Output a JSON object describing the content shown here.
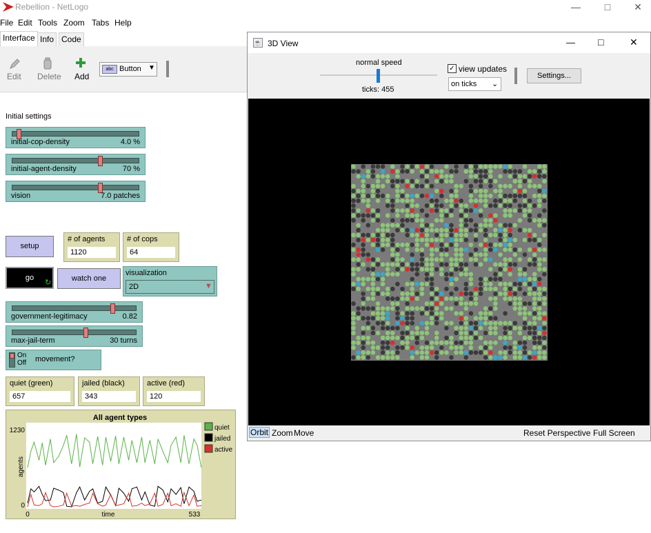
{
  "window": {
    "title": "Rebellion - NetLogo"
  },
  "menu": [
    "File",
    "Edit",
    "Tools",
    "Zoom",
    "Tabs",
    "Help"
  ],
  "tabs": [
    {
      "label": "Interface"
    },
    {
      "label": "Info"
    },
    {
      "label": "Code"
    }
  ],
  "toolbar": {
    "edit": "Edit",
    "delete": "Delete",
    "add": "Add",
    "widget_type": "Button"
  },
  "interface": {
    "section_label": "Initial settings",
    "sliders": [
      {
        "name": "initial-cop-density",
        "value": "4.0 %",
        "fraction": 0.04
      },
      {
        "name": "initial-agent-density",
        "value": "70 %",
        "fraction": 0.7
      },
      {
        "name": "vision",
        "value": "7.0 patches",
        "fraction": 0.7
      },
      {
        "name": "government-legitimacy",
        "value": "0.82",
        "fraction": 0.82
      },
      {
        "name": "max-jail-term",
        "value": "30 turns",
        "fraction": 0.6
      }
    ],
    "setup_label": "setup",
    "go_label": "go",
    "watch_label": "watch one",
    "agents_monitor": {
      "label": "# of agents",
      "value": "1120"
    },
    "cops_monitor": {
      "label": "# of cops",
      "value": "64"
    },
    "visualization": {
      "label": "visualization",
      "value": "2D"
    },
    "movement": {
      "on": "On",
      "off": "Off",
      "label": "movement?"
    },
    "quiet_monitor": {
      "label": "quiet (green)",
      "value": "657"
    },
    "jailed_monitor": {
      "label": "jailed (black)",
      "value": "343"
    },
    "active_monitor": {
      "label": "active (red)",
      "value": "120"
    }
  },
  "chart_data": {
    "type": "line",
    "title": "All agent types",
    "xlabel": "time",
    "ylabel": "agents",
    "xlim": [
      0,
      533
    ],
    "ylim": [
      0,
      1230
    ],
    "x_tick_labels": [
      "0",
      "533"
    ],
    "y_tick_labels": [
      "0",
      "1230"
    ],
    "series": [
      {
        "name": "quiet",
        "color": "#59b346",
        "x": [
          0,
          10,
          20,
          35,
          45,
          55,
          70,
          80,
          95,
          110,
          120,
          135,
          150,
          160,
          175,
          190,
          200,
          215,
          230,
          240,
          255,
          270,
          280,
          295,
          310,
          320,
          335,
          350,
          360,
          375,
          390,
          400,
          415,
          430,
          440,
          455,
          470,
          480,
          495,
          510,
          520,
          533
        ],
        "values": [
          640,
          900,
          1050,
          760,
          1040,
          680,
          1100,
          720,
          820,
          1000,
          1160,
          700,
          1180,
          650,
          1120,
          1050,
          700,
          1140,
          680,
          1130,
          740,
          1150,
          700,
          1130,
          760,
          1080,
          720,
          1130,
          720,
          1080,
          700,
          1100,
          900,
          720,
          1000,
          1130,
          720,
          1160,
          700,
          1100,
          1000,
          640
        ]
      },
      {
        "name": "jailed",
        "color": "#000000",
        "x": [
          0,
          10,
          20,
          35,
          45,
          55,
          70,
          80,
          95,
          110,
          120,
          135,
          150,
          160,
          175,
          190,
          200,
          215,
          230,
          240,
          255,
          270,
          280,
          295,
          310,
          320,
          335,
          350,
          360,
          375,
          390,
          400,
          415,
          430,
          440,
          455,
          470,
          480,
          495,
          510,
          520,
          533
        ],
        "values": [
          70,
          300,
          250,
          340,
          210,
          110,
          120,
          310,
          280,
          240,
          20,
          10,
          240,
          330,
          120,
          260,
          300,
          70,
          100,
          330,
          200,
          30,
          310,
          230,
          100,
          300,
          330,
          120,
          250,
          40,
          20,
          340,
          280,
          90,
          300,
          210,
          320,
          60,
          330,
          260,
          100,
          120
        ]
      },
      {
        "name": "active",
        "color": "#d73229",
        "x": [
          0,
          10,
          20,
          35,
          45,
          55,
          70,
          80,
          95,
          110,
          120,
          135,
          150,
          160,
          175,
          190,
          200,
          215,
          230,
          240,
          255,
          270,
          280,
          295,
          310,
          320,
          335,
          350,
          360,
          375,
          390,
          400,
          415,
          430,
          440,
          455,
          470,
          480,
          495,
          510,
          520,
          533
        ],
        "values": [
          10,
          210,
          40,
          30,
          60,
          240,
          30,
          10,
          20,
          40,
          230,
          20,
          30,
          20,
          50,
          70,
          230,
          60,
          20,
          40,
          210,
          30,
          40,
          60,
          230,
          20,
          30,
          70,
          30,
          60,
          230,
          20,
          50,
          230,
          30,
          60,
          20,
          240,
          30,
          200,
          20,
          30
        ]
      }
    ]
  },
  "view3d": {
    "title": "3D View",
    "speed_label": "normal speed",
    "ticks": "ticks: 455",
    "view_updates": "view updates",
    "update_mode": "on ticks",
    "settings": "Settings...",
    "orbit": "Orbit",
    "zoom": "Zoom",
    "move": "Move",
    "reset": "Reset Perspective",
    "fullscreen": "Full Screen"
  },
  "colors": {
    "slider_bg": "#8fc6bf",
    "button_bg": "#c5c5ef",
    "monitor_bg": "#dcdcaf",
    "quiet": "#8ec47a",
    "jailed": "#3a3a3a",
    "active": "#d43030",
    "cop": "#3ca6c8"
  }
}
